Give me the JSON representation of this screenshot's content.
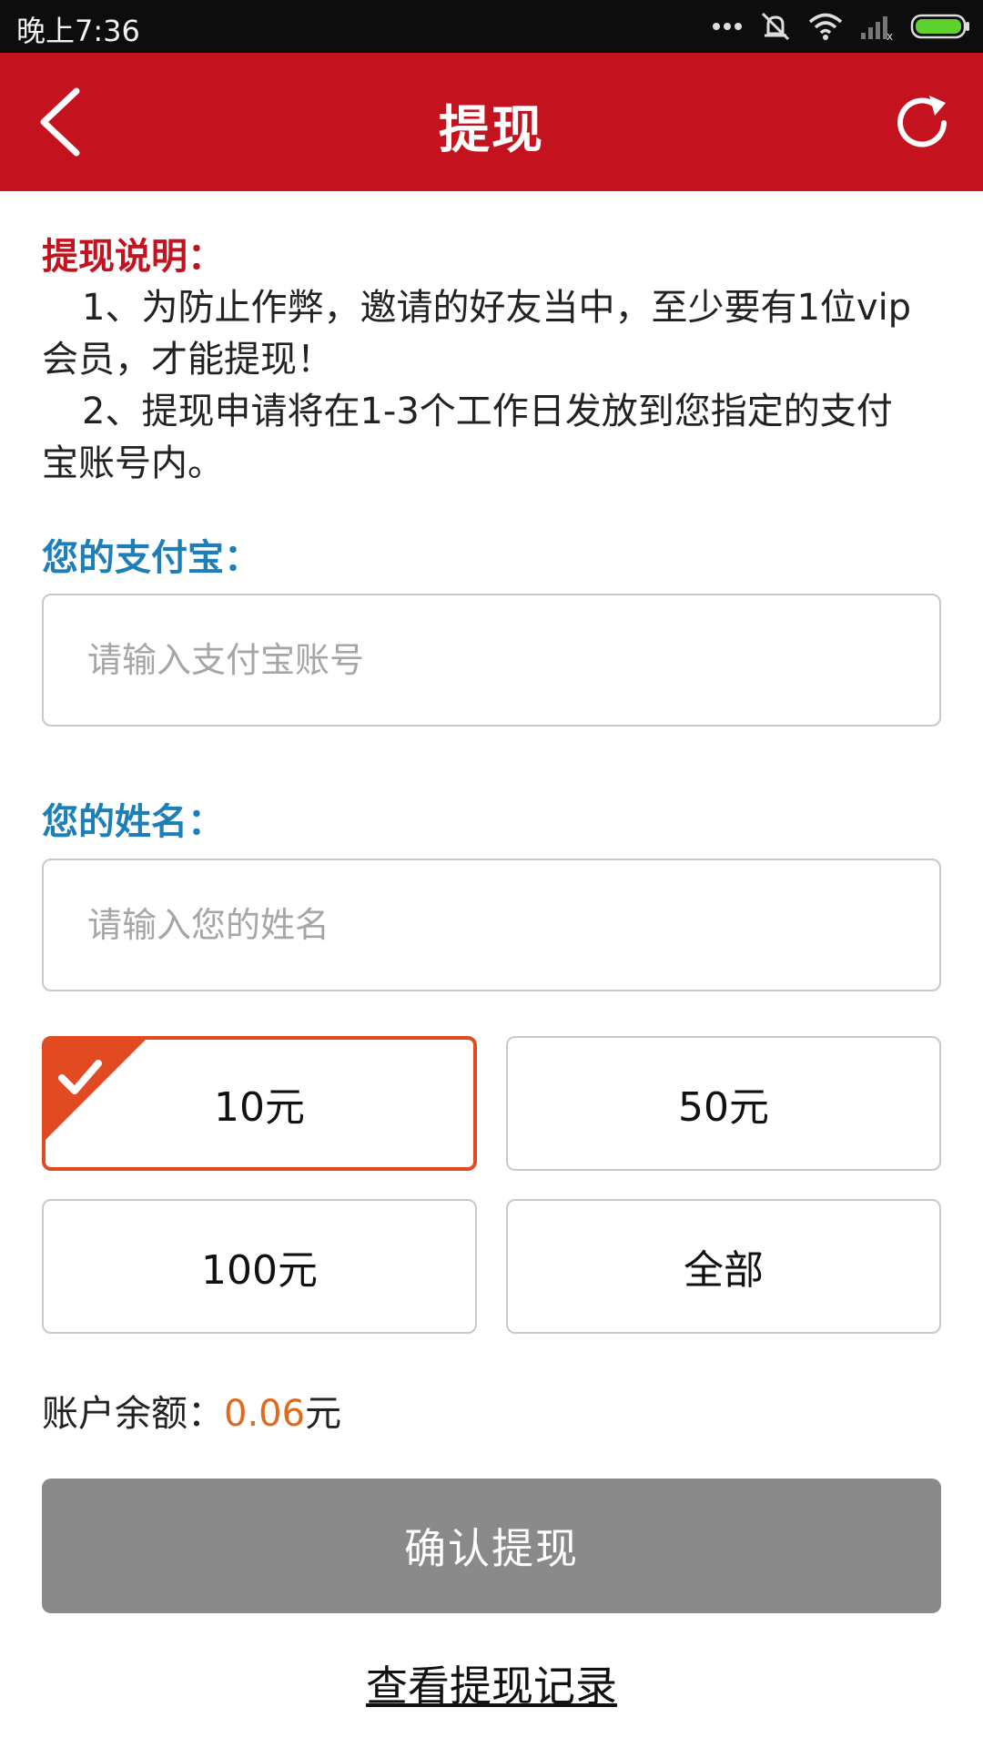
{
  "status": {
    "time": "晚上7:36"
  },
  "header": {
    "title": "提现"
  },
  "notes": {
    "title": "提现说明：",
    "line1a": "1、为防止作弊，邀请的好友当中，至少要有1位vip",
    "line1b": "会员，才能提现！",
    "line2a": "2、提现申请将在1-3个工作日发放到您指定的支付",
    "line2b": "宝账号内。"
  },
  "form": {
    "alipay_label": "您的支付宝：",
    "alipay_placeholder": "请输入支付宝账号",
    "name_label": "您的姓名：",
    "name_placeholder": "请输入您的姓名"
  },
  "amounts": [
    "10元",
    "50元",
    "100元",
    "全部"
  ],
  "selected_amount_index": 0,
  "balance": {
    "label": "账户余额：",
    "value": "0.06",
    "unit": "元"
  },
  "confirm_label": "确认提现",
  "records_link": "查看提现记录",
  "colors": {
    "header": "#c5121f",
    "label_blue": "#1d7fb8",
    "selected": "#e24a22",
    "button": "#8a8a8a"
  }
}
